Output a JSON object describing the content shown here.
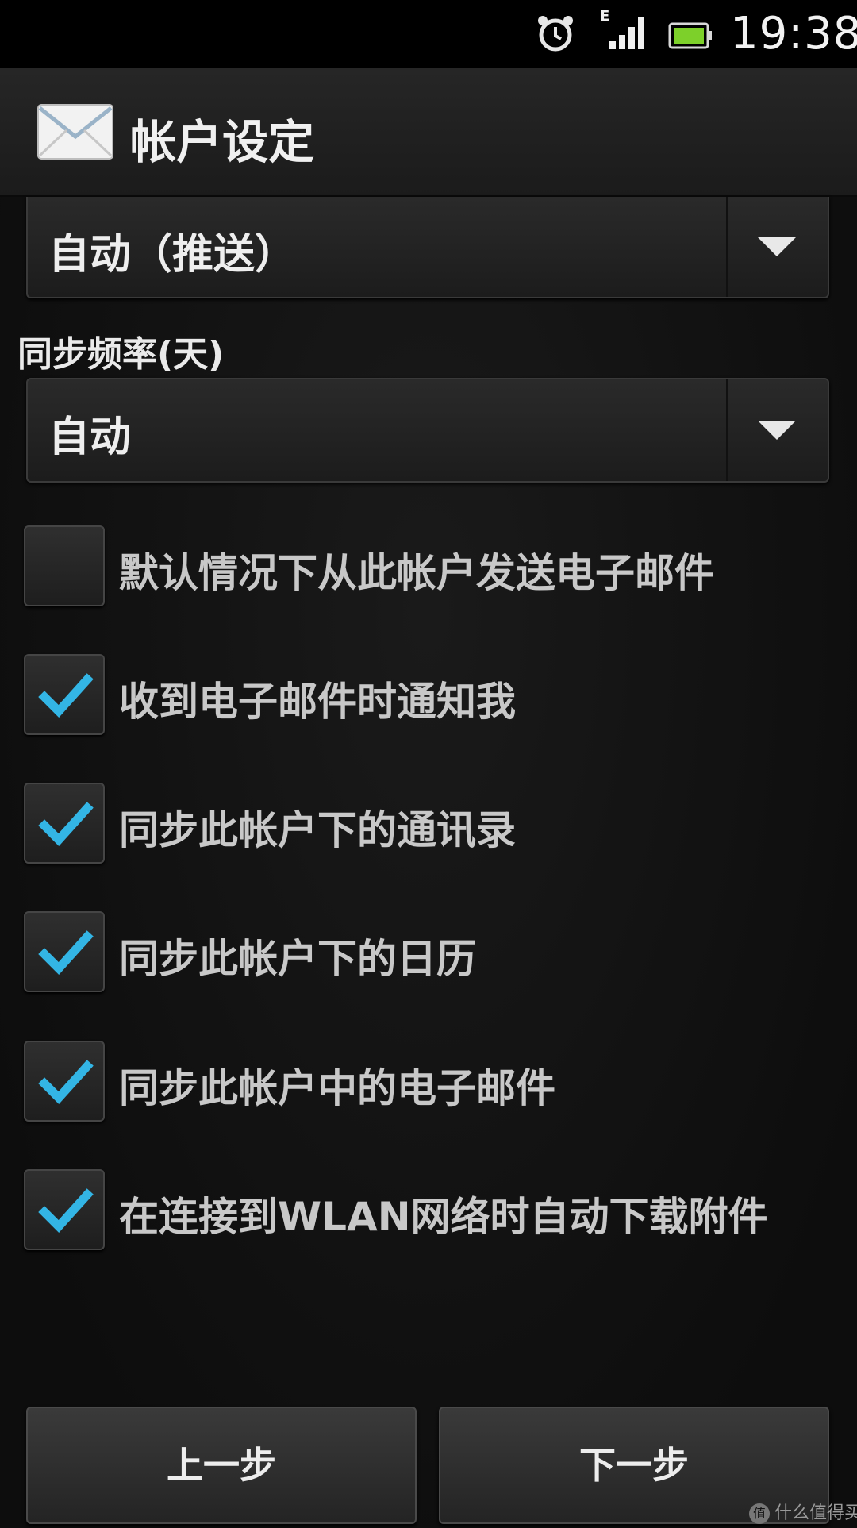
{
  "status_bar": {
    "time": "19:38",
    "network_type": "E",
    "icons": [
      "alarm-icon",
      "signal-icon",
      "battery-icon"
    ]
  },
  "header": {
    "title": "帐户设定",
    "icon": "mail-icon"
  },
  "push_spinner": {
    "value": "自动（推送）"
  },
  "sync_frequency": {
    "label": "同步频率(天)",
    "value": "自动"
  },
  "options": [
    {
      "label": "默认情况下从此帐户发送电子邮件",
      "checked": false
    },
    {
      "label": "收到电子邮件时通知我",
      "checked": true
    },
    {
      "label": "同步此帐户下的通讯录",
      "checked": true
    },
    {
      "label": "同步此帐户下的日历",
      "checked": true
    },
    {
      "label": "同步此帐户中的电子邮件",
      "checked": true
    },
    {
      "label": "在连接到WLAN网络时自动下载附件",
      "checked": true
    }
  ],
  "buttons": {
    "prev": "上一步",
    "next": "下一步"
  },
  "watermark": "什么值得买",
  "colors": {
    "check_accent": "#33b5e5",
    "background": "#0f0f0f"
  }
}
